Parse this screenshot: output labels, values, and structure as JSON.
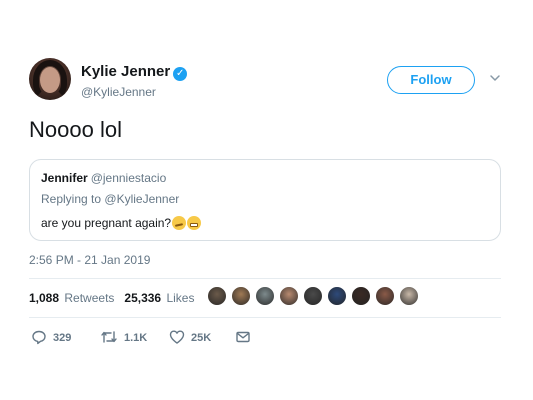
{
  "author": {
    "name": "Kylie Jenner",
    "handle": "@KylieJenner",
    "verified": true
  },
  "follow_button": {
    "label": "Follow"
  },
  "tweet": {
    "text": "Noooo lol",
    "timestamp": "2:56 PM - 21 Jan 2019"
  },
  "quoted_tweet": {
    "name": "Jennifer",
    "handle": "@jenniestacio",
    "replying_prefix": "Replying to",
    "replying_to": "@KylieJenner",
    "text": "are you pregnant again?",
    "emojis": [
      "smirking-face-icon",
      "grimacing-face-icon"
    ]
  },
  "stats": {
    "retweets_count": "1,088",
    "retweets_label": "Retweets",
    "likes_count": "25,336",
    "likes_label": "Likes"
  },
  "likers_avatars": [
    {
      "color": "#6b5a4a"
    },
    {
      "color": "#a07a55"
    },
    {
      "color": "#7d8a8c"
    },
    {
      "color": "#b88a70"
    },
    {
      "color": "#4a4a4a"
    },
    {
      "color": "#2e4a7a"
    },
    {
      "color": "#3a2a24"
    },
    {
      "color": "#8a5a48"
    },
    {
      "color": "#c8b8a8"
    }
  ],
  "actions": {
    "reply_count": "329",
    "retweet_count": "1.1K",
    "like_count": "25K"
  },
  "colors": {
    "accent": "#1da1f2",
    "secondary_text": "#657786",
    "border": "#e6ecf0"
  }
}
